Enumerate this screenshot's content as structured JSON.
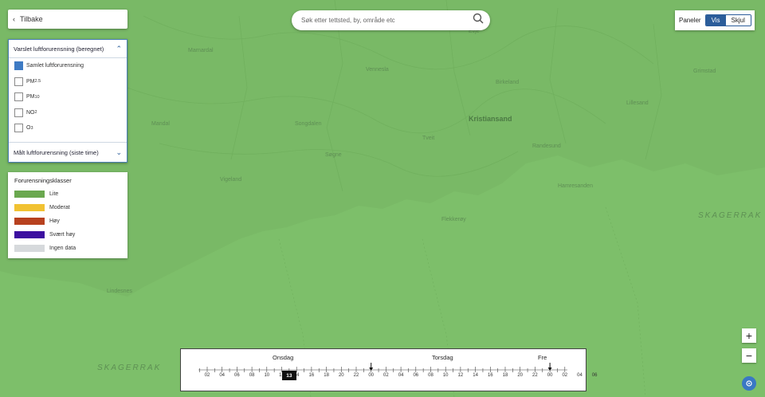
{
  "back_button": {
    "label": "Tilbake"
  },
  "search": {
    "placeholder": "Søk etter tettsted, by, område etc"
  },
  "panels_toggle": {
    "label": "Paneler",
    "show": "Vis",
    "hide": "Skjul",
    "selected": "Vis"
  },
  "layers": {
    "forecast_header": "Varslet luftforurensning (beregnet)",
    "options": [
      {
        "label": "Samlet luftforurensning",
        "sub": "",
        "checked": true
      },
      {
        "label": "PM",
        "sub": "2.5",
        "checked": false
      },
      {
        "label": "PM",
        "sub": "10",
        "checked": false
      },
      {
        "label": "NO",
        "sub": "2",
        "checked": false
      },
      {
        "label": "O",
        "sub": "3",
        "checked": false
      }
    ],
    "measured_header": "Målt luftforurensning (siste time)"
  },
  "legend": {
    "title": "Forurensningsklasser",
    "items": [
      {
        "label": "Lite",
        "color": "#6aa84f"
      },
      {
        "label": "Moderat",
        "color": "#f1c232"
      },
      {
        "label": "Høy",
        "color": "#b7411f"
      },
      {
        "label": "Svært høy",
        "color": "#3c0fa0"
      },
      {
        "label": "Ingen data",
        "color": "#d6d9dc"
      }
    ]
  },
  "map": {
    "fill_color": "#7dbf6a",
    "sea_labels": [
      "SKAGERRAK",
      "SKAGERRAK"
    ],
    "city": "Kristiansand",
    "places": [
      "Vennesla",
      "Lillesand",
      "Grimstad",
      "Mandal",
      "Songdalen",
      "Søgne",
      "Tveit",
      "Birkeland",
      "Vigeland",
      "Flekkerøy",
      "Randesund",
      "Hamresanden",
      "Lindesnes",
      "Marnardal",
      "Evje"
    ]
  },
  "timeline": {
    "days": [
      "Onsdag",
      "Torsdag",
      "Fre"
    ],
    "hours": [
      "02",
      "04",
      "06",
      "08",
      "10",
      "12",
      "14",
      "16",
      "18",
      "20",
      "22",
      "00",
      "02",
      "04",
      "06",
      "08",
      "10",
      "12",
      "14",
      "16",
      "18",
      "20",
      "22",
      "00",
      "02",
      "04",
      "06"
    ],
    "current_hour": "13"
  },
  "zoom": {
    "in": "+",
    "out": "−"
  }
}
